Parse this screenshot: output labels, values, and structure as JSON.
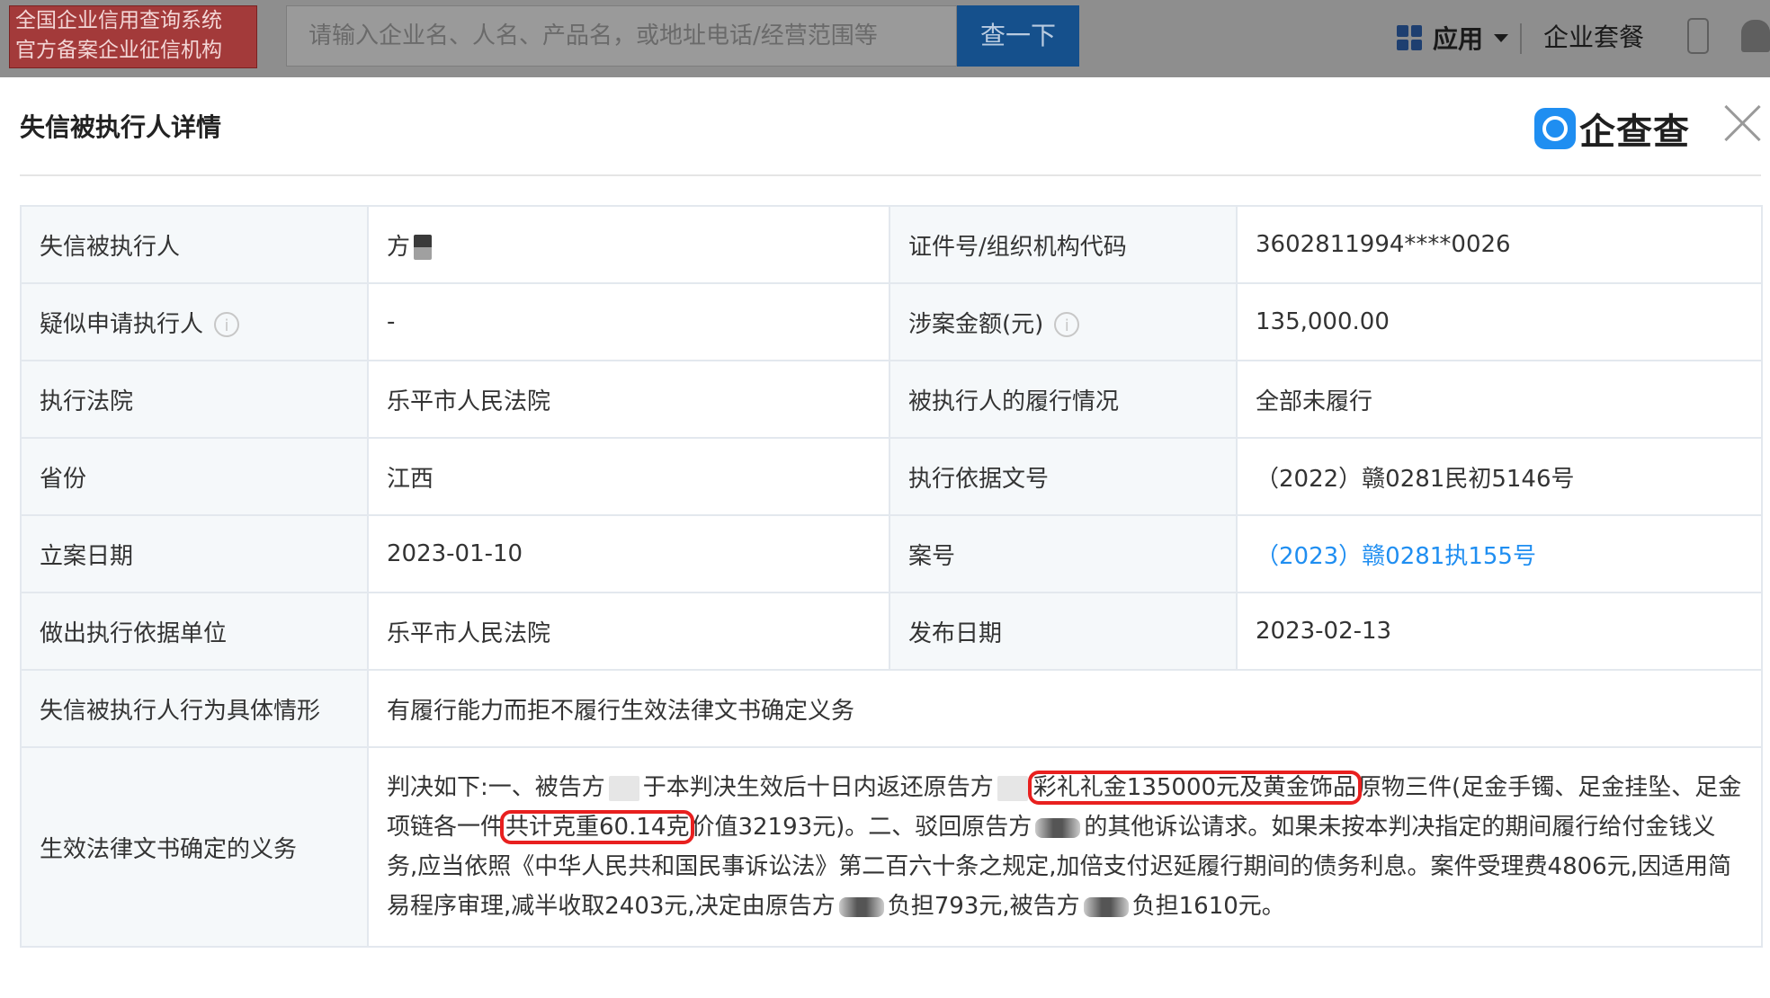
{
  "topbar": {
    "badge_line1": "全国企业信用查询系统",
    "badge_line2": "官方备案企业征信机构",
    "search_placeholder": "请输入企业名、人名、产品名，或地址电话/经营范围等",
    "search_button": "查一下",
    "apps_label": "应用",
    "package_label": "企业套餐"
  },
  "modal": {
    "title": "失信被执行人详情",
    "logo_text": "企查查"
  },
  "rows": {
    "r1": {
      "l1": "失信被执行人",
      "v1": "方",
      "l2": "证件号/组织机构代码",
      "v2": "3602811994****0026"
    },
    "r2": {
      "l1": "疑似申请执行人",
      "v1": "-",
      "l2": "涉案金额(元)",
      "v2": "135,000.00"
    },
    "r3": {
      "l1": "执行法院",
      "v1": "乐平市人民法院",
      "l2": "被执行人的履行情况",
      "v2": "全部未履行"
    },
    "r4": {
      "l1": "省份",
      "v1": "江西",
      "l2": "执行依据文号",
      "v2": "（2022）赣0281民初5146号"
    },
    "r5": {
      "l1": "立案日期",
      "v1": "2023-01-10",
      "l2": "案号",
      "v2": "（2023）赣0281执155号"
    },
    "r6": {
      "l1": "做出执行依据单位",
      "v1": "乐平市人民法院",
      "l2": "发布日期",
      "v2": "2023-02-13"
    },
    "r7": {
      "l1": "失信被执行人行为具体情形",
      "v1": "有履行能力而拒不履行生效法律文书确定义务"
    },
    "r8": {
      "l1": "生效法律文书确定的义务",
      "t1": "判决如下:一、被告方",
      "t2": "于本判决生效后十日内返还原告方",
      "t3": "彩礼礼金135000元及黄金饰品",
      "t4": "原物三件(足金手镯、足金挂坠、足金项链各一件",
      "t5": "共计克重60.14克",
      "t6": "价值32193元)。二、驳回原告方",
      "t7": "的其他诉讼请求。如果未按本判决指定的期间履行给付金钱义务,应当依照《中华人民共和国民事诉讼法》第二百六十条之规定,加倍支付迟延履行期间的债务利息。案件受理费4806元,因适用简易程序审理,减半收取2403元,决定由原告方",
      "t8": "负担793元,被告方",
      "t9": "负担1610元。"
    }
  },
  "icons": {
    "hint": "info-icon",
    "close": "close-icon",
    "logo": "qichacha-logo-icon"
  },
  "colors": {
    "link": "#1f8ef1",
    "highlight": "#e8201f",
    "label_bg": "#f5f8fa"
  }
}
